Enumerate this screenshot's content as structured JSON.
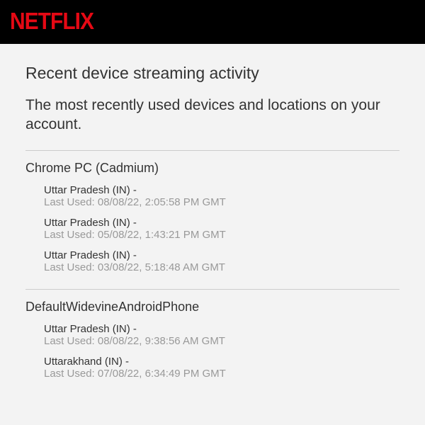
{
  "brand": "NETFLIX",
  "page": {
    "title": "Recent device streaming activity",
    "subtitle": "The most recently used devices and locations on your account."
  },
  "devices": [
    {
      "name": "Chrome PC (Cadmium)",
      "sessions": [
        {
          "location": "Uttar Pradesh (IN) -",
          "lastused": "Last Used: 08/08/22, 2:05:58 PM GMT"
        },
        {
          "location": "Uttar Pradesh (IN) -",
          "lastused": "Last Used: 05/08/22, 1:43:21 PM GMT"
        },
        {
          "location": "Uttar Pradesh (IN) -",
          "lastused": "Last Used: 03/08/22, 5:18:48 AM GMT"
        }
      ]
    },
    {
      "name": "DefaultWidevineAndroidPhone",
      "sessions": [
        {
          "location": "Uttar Pradesh (IN) -",
          "lastused": "Last Used: 08/08/22, 9:38:56 AM GMT"
        },
        {
          "location": "Uttarakhand (IN) -",
          "lastused": "Last Used: 07/08/22, 6:34:49 PM GMT"
        }
      ]
    }
  ]
}
